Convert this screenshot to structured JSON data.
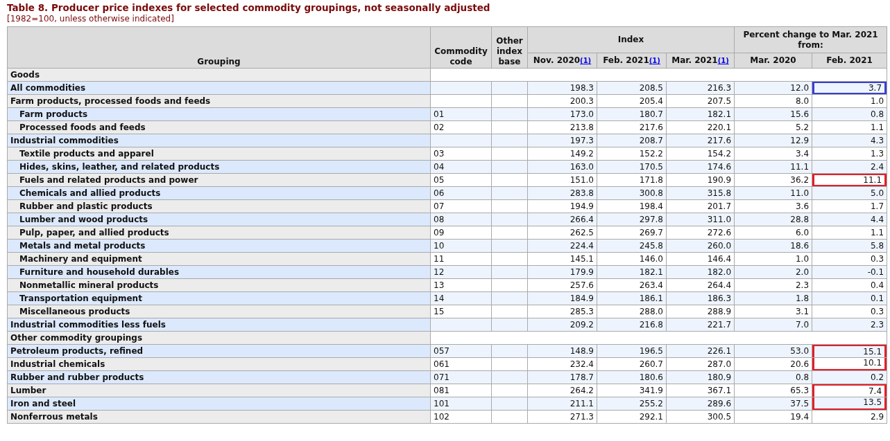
{
  "title": "Table 8. Producer price indexes for selected commodity groupings, not seasonally adjusted",
  "subtitle": "[1982=100, unless otherwise indicated]",
  "header": {
    "grouping": "Grouping",
    "code": "Commodity code",
    "base": "Other index base",
    "index": "Index",
    "percent": "Percent change to Mar. 2021 from:",
    "columns": [
      {
        "label": "Nov. 2020",
        "note": "(1)"
      },
      {
        "label": "Feb. 2021",
        "note": "(1)"
      },
      {
        "label": "Mar. 2021",
        "note": "(1)"
      },
      {
        "label": "Mar. 2020"
      },
      {
        "label": "Feb. 2021"
      }
    ]
  },
  "sections": [
    {
      "label": "Goods",
      "rows": [
        {
          "label": "All commodities",
          "values": [
            "198.3",
            "208.5",
            "216.3",
            "12.0",
            "3.7"
          ],
          "color": "#3b3fd0"
        },
        {
          "label": "Farm products, processed foods and feeds",
          "values": [
            "200.3",
            "205.4",
            "207.5",
            "8.0",
            "1.0"
          ],
          "children": [
            {
              "label": "Farm products",
              "code": "01",
              "values": [
                "173.0",
                "180.7",
                "182.1",
                "15.6",
                "0.8"
              ]
            },
            {
              "label": "Processed foods and feeds",
              "code": "02",
              "values": [
                "213.8",
                "217.6",
                "220.1",
                "5.2",
                "1.1"
              ]
            }
          ]
        },
        {
          "label": "Industrial commodities",
          "values": [
            "197.3",
            "208.7",
            "217.6",
            "12.9",
            "4.3"
          ],
          "children": [
            {
              "label": "Textile products and apparel",
              "code": "03",
              "values": [
                "149.2",
                "152.2",
                "154.2",
                "3.4",
                "1.3"
              ]
            },
            {
              "label": "Hides, skins, leather, and related products",
              "code": "04",
              "values": [
                "163.0",
                "170.5",
                "174.6",
                "11.1",
                "2.4"
              ]
            },
            {
              "label": "Fuels and related products and power",
              "code": "05",
              "values": [
                "151.0",
                "171.8",
                "190.9",
                "36.2",
                "11.1"
              ],
              "color": "#e0202a"
            },
            {
              "label": "Chemicals and allied products",
              "code": "06",
              "values": [
                "283.8",
                "300.8",
                "315.8",
                "11.0",
                "5.0"
              ]
            },
            {
              "label": "Rubber and plastic products",
              "code": "07",
              "values": [
                "194.9",
                "198.4",
                "201.7",
                "3.6",
                "1.7"
              ]
            },
            {
              "label": "Lumber and wood products",
              "code": "08",
              "values": [
                "266.4",
                "297.8",
                "311.0",
                "28.8",
                "4.4"
              ]
            },
            {
              "label": "Pulp, paper, and allied products",
              "code": "09",
              "values": [
                "262.5",
                "269.7",
                "272.6",
                "6.0",
                "1.1"
              ]
            },
            {
              "label": "Metals and metal products",
              "code": "10",
              "values": [
                "224.4",
                "245.8",
                "260.0",
                "18.6",
                "5.8"
              ]
            },
            {
              "label": "Machinery and equipment",
              "code": "11",
              "values": [
                "145.1",
                "146.0",
                "146.4",
                "1.0",
                "0.3"
              ]
            },
            {
              "label": "Furniture and household durables",
              "code": "12",
              "values": [
                "179.9",
                "182.1",
                "182.0",
                "2.0",
                "-0.1"
              ]
            },
            {
              "label": "Nonmetallic mineral products",
              "code": "13",
              "values": [
                "257.6",
                "263.4",
                "264.4",
                "2.3",
                "0.4"
              ]
            },
            {
              "label": "Transportation equipment",
              "code": "14",
              "values": [
                "184.9",
                "186.1",
                "186.3",
                "1.8",
                "0.1"
              ]
            },
            {
              "label": "Miscellaneous products",
              "code": "15",
              "values": [
                "285.3",
                "288.0",
                "288.9",
                "3.1",
                "0.3"
              ]
            }
          ]
        },
        {
          "label": "Industrial commodities less fuels",
          "values": [
            "209.2",
            "216.8",
            "221.7",
            "7.0",
            "2.3"
          ]
        }
      ]
    },
    {
      "label": "Other commodity groupings",
      "rows": [
        {
          "label": "Petroleum products, refined",
          "code": "057",
          "values": [
            "148.9",
            "196.5",
            "226.1",
            "53.0",
            "15.1"
          ],
          "color": "#e0202a"
        },
        {
          "label": "Industrial chemicals",
          "code": "061",
          "values": [
            "232.4",
            "260.7",
            "287.0",
            "20.6",
            "10.1"
          ],
          "color": "#e0202a"
        },
        {
          "label": "Rubber and rubber products",
          "code": "071",
          "values": [
            "178.7",
            "180.6",
            "180.9",
            "0.8",
            "0.2"
          ]
        },
        {
          "label": "Lumber",
          "code": "081",
          "values": [
            "264.2",
            "341.9",
            "367.1",
            "65.3",
            "7.4"
          ],
          "color": "#e0202a"
        },
        {
          "label": "Iron and steel",
          "code": "101",
          "values": [
            "211.1",
            "255.2",
            "289.6",
            "37.5",
            "13.5"
          ],
          "color": "#e0202a"
        },
        {
          "label": "Nonferrous metals",
          "code": "102",
          "values": [
            "271.3",
            "292.1",
            "300.5",
            "19.4",
            "2.9"
          ]
        }
      ]
    }
  ]
}
